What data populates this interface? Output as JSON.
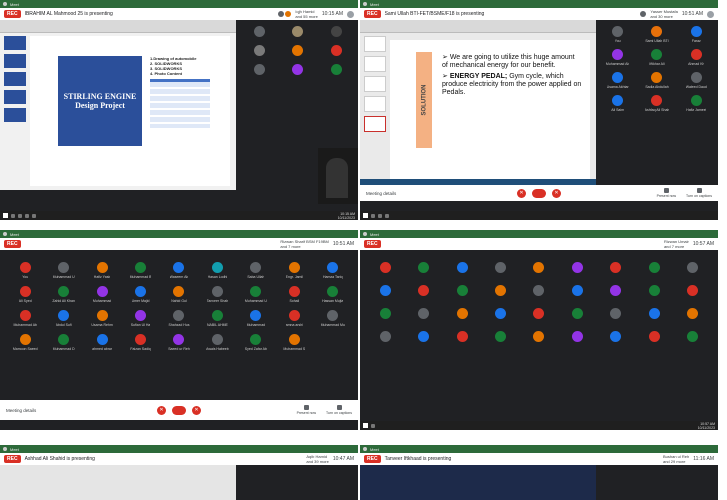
{
  "tiles": [
    {
      "id": "t1",
      "rec": "REC",
      "presenting": "IBRAHIM AL Mahmood 25 is presenting",
      "host": "Iqjh Hamid\nand 55 more",
      "time": "10:15 AM",
      "clock": "10:15 AM\n10/11/2023",
      "slide": {
        "title": "STIRLING ENGINE Design Project",
        "menu": [
          "1.Drawing of automobile",
          "2. SOLIDWORKS",
          "3. SOLIDWORKS",
          "4. Photo Content"
        ]
      },
      "icons": [
        "search-icon",
        "mic-icon"
      ]
    },
    {
      "id": "t2",
      "rec": "REC",
      "presenting": "Sami Ullah BTI-FET/BSME/F18 is presenting",
      "host": "Yasser Mustafa\nand 30 more",
      "time": "10:51 AM",
      "slide": {
        "side_label": "SOLUTION",
        "line1": "We are going to utilize this huge amount of mechanical energy for our benefit.",
        "line2_bold": "ENERGY PEDAL;",
        "line2": "Gym cycle, which produce electricity from the power applied on Pedals."
      },
      "controls": {
        "details": "Meeting details",
        "present": "Present now",
        "turn_on": "Turn on captions",
        "user": "Sami Ullah BTI-FET/BSME/F18 is presenting"
      },
      "participants": [
        {
          "name": "You",
          "color": "#5f6368"
        },
        {
          "name": "Sami Ullah BTI",
          "color": "#e8710a"
        },
        {
          "name": "Faraz",
          "color": "#1a73e8"
        },
        {
          "name": "Muhammad Ab",
          "color": "#9334e6"
        },
        {
          "name": "Iftikhar Ali",
          "color": "#188038"
        },
        {
          "name": "Ahmad Kh",
          "color": "#d93025"
        },
        {
          "name": "Usama Akhtar",
          "color": "#1a73e8"
        },
        {
          "name": "Sadia Abdullah",
          "color": "#e37400"
        },
        {
          "name": "Waleed Daud",
          "color": "#5f6368"
        },
        {
          "name": "Ali Saim",
          "color": "#1a73e8"
        },
        {
          "name": "Ashfaq Ali Shah",
          "color": "#d93025"
        },
        {
          "name": "Hafiz Jameel",
          "color": "#188038"
        }
      ]
    },
    {
      "id": "t3",
      "rec": "REC",
      "presenting": "",
      "host": "Rizwan Sharif BSM F19BM\nand 7 more",
      "time": "10:51 AM",
      "controls": {
        "details": "Meeting details",
        "present": "Present now",
        "turn_on": "Turn on captions",
        "user": "Present now"
      },
      "participants": [
        {
          "name": "You",
          "color": "#d93025"
        },
        {
          "name": "Muhammad U",
          "color": "#5f6368"
        },
        {
          "name": "Hafiz Yasir",
          "color": "#e37400"
        },
        {
          "name": "Muhammad B",
          "color": "#188038"
        },
        {
          "name": "Waseem Ab",
          "color": "#1a73e8"
        },
        {
          "name": "Hasan Lodhi",
          "color": "#129eaf"
        },
        {
          "name": "Saba Ullah",
          "color": "#5f6368"
        },
        {
          "name": "Engr. Jamil",
          "color": "#e37400"
        },
        {
          "name": "Hamza Tariq",
          "color": "#1a73e8"
        },
        {
          "name": "Ali Syed",
          "color": "#d93025"
        },
        {
          "name": "Zahid Ali Khan",
          "color": "#188038"
        },
        {
          "name": "Muhammad",
          "color": "#9334e6"
        },
        {
          "name": "Umer Majid",
          "color": "#1a73e8"
        },
        {
          "name": "Nahid Gul",
          "color": "#e37400"
        },
        {
          "name": "Tanveer Shah",
          "color": "#5f6368"
        },
        {
          "name": "Muhammad U",
          "color": "#188038"
        },
        {
          "name": "Sohail",
          "color": "#d93025"
        },
        {
          "name": "Hassan Mujta",
          "color": "#188038"
        },
        {
          "name": "Muhammad Ab",
          "color": "#d93025"
        },
        {
          "name": "Abdul Sufi",
          "color": "#1a73e8"
        },
        {
          "name": "Usama Rehm",
          "color": "#e37400"
        },
        {
          "name": "Sufian Ul Ha",
          "color": "#9334e6"
        },
        {
          "name": "Shahzad Hus",
          "color": "#5f6368"
        },
        {
          "name": "NABIL AHME",
          "color": "#188038"
        },
        {
          "name": "Muhammad",
          "color": "#1a73e8"
        },
        {
          "name": "amna arshi",
          "color": "#d93025"
        },
        {
          "name": "Muhammad Mu",
          "color": "#5f6368"
        },
        {
          "name": "Mamoon Saeed",
          "color": "#e37400"
        },
        {
          "name": "Muhammad D",
          "color": "#188038"
        },
        {
          "name": "ahmed abrar",
          "color": "#1a73e8"
        },
        {
          "name": "Faizan Sadiq",
          "color": "#d93025"
        },
        {
          "name": "Saeed ur Reh",
          "color": "#9334e6"
        },
        {
          "name": "Awais Habeeb",
          "color": "#5f6368"
        },
        {
          "name": "Syed Zafar Ab",
          "color": "#188038"
        },
        {
          "name": "Muhammad S",
          "color": "#e37400"
        }
      ]
    },
    {
      "id": "t4",
      "rec": "REC",
      "presenting": "",
      "host": "Rizwan Umair\nand 7 more",
      "time": "10:57 AM",
      "clock": "10:57 AM\n10/11/2023",
      "participants": [
        {
          "name": "",
          "color": "#d93025"
        },
        {
          "name": "",
          "color": "#188038"
        },
        {
          "name": "",
          "color": "#1a73e8"
        },
        {
          "name": "",
          "color": "#5f6368"
        },
        {
          "name": "",
          "color": "#e37400"
        },
        {
          "name": "",
          "color": "#9334e6"
        },
        {
          "name": "",
          "color": "#d93025"
        },
        {
          "name": "",
          "color": "#188038"
        },
        {
          "name": "",
          "color": "#5f6368"
        },
        {
          "name": "",
          "color": "#1a73e8"
        },
        {
          "name": "",
          "color": "#d93025"
        },
        {
          "name": "",
          "color": "#188038"
        },
        {
          "name": "",
          "color": "#e37400"
        },
        {
          "name": "",
          "color": "#5f6368"
        },
        {
          "name": "",
          "color": "#1a73e8"
        },
        {
          "name": "",
          "color": "#9334e6"
        },
        {
          "name": "",
          "color": "#188038"
        },
        {
          "name": "",
          "color": "#d93025"
        },
        {
          "name": "",
          "color": "#188038"
        },
        {
          "name": "",
          "color": "#5f6368"
        },
        {
          "name": "",
          "color": "#e37400"
        },
        {
          "name": "",
          "color": "#1a73e8"
        },
        {
          "name": "",
          "color": "#d93025"
        },
        {
          "name": "",
          "color": "#188038"
        },
        {
          "name": "",
          "color": "#5f6368"
        },
        {
          "name": "",
          "color": "#1a73e8"
        },
        {
          "name": "",
          "color": "#e37400"
        },
        {
          "name": "",
          "color": "#5f6368"
        },
        {
          "name": "",
          "color": "#1a73e8"
        },
        {
          "name": "",
          "color": "#d93025"
        },
        {
          "name": "",
          "color": "#188038"
        },
        {
          "name": "",
          "color": "#e37400"
        },
        {
          "name": "",
          "color": "#9334e6"
        },
        {
          "name": "",
          "color": "#1a73e8"
        },
        {
          "name": "",
          "color": "#d93025"
        },
        {
          "name": "",
          "color": "#188038"
        }
      ]
    },
    {
      "id": "t5",
      "rec": "REC",
      "presenting": "Ashhad Ali Shahid is presenting",
      "host": "Aqib Hamid\nand 39 more",
      "time": "10:47 AM"
    },
    {
      "id": "t6",
      "rec": "REC",
      "presenting": "Tanveer Iftkhaad is presenting",
      "host": "Bushan ul Reh\nand 29 more",
      "time": "11:16 AM"
    }
  ]
}
